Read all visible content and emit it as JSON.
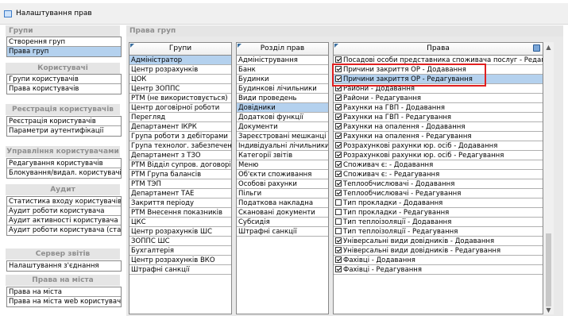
{
  "window": {
    "title": "Налаштування прав"
  },
  "sidebar": {
    "sections": [
      {
        "title": "Групи",
        "items": [
          {
            "label": "Створення груп",
            "selected": false
          },
          {
            "label": "Права груп",
            "selected": true
          }
        ]
      },
      {
        "title": "Користувачі",
        "items": [
          {
            "label": "Групи користувачів",
            "selected": false
          },
          {
            "label": "Права користувачів",
            "selected": false
          }
        ]
      },
      {
        "title": "Реєстрація користувачів",
        "items": [
          {
            "label": "Реєстрація користувачів",
            "selected": false
          },
          {
            "label": "Параметри аутентифікації",
            "selected": false
          }
        ]
      },
      {
        "title": "Управління користувачами",
        "items": [
          {
            "label": "Редагування користувачів",
            "selected": false
          },
          {
            "label": "Блокування/видал. користувачів",
            "selected": false
          }
        ]
      },
      {
        "title": "Аудит",
        "items": [
          {
            "label": "Статистика входу користувачів",
            "selected": false
          },
          {
            "label": "Аудит роботи користувача",
            "selected": false
          },
          {
            "label": "Аудит активності користувача",
            "selected": false
          },
          {
            "label": "Аудит роботи користувача (стари",
            "selected": false
          }
        ]
      },
      {
        "title": "Сервер звітів",
        "items": [
          {
            "label": "Налаштування з'єднання",
            "selected": false
          }
        ]
      },
      {
        "title": "Права на міста",
        "items": [
          {
            "label": "Права на міста",
            "selected": false
          },
          {
            "label": "Права на міста web користувачів",
            "selected": false
          }
        ]
      }
    ]
  },
  "main": {
    "title": "Права груп",
    "groups": {
      "header": "Групи",
      "rows": [
        {
          "label": "Адміністратор",
          "selected": true
        },
        {
          "label": "Центр розрахунків",
          "selected": false
        },
        {
          "label": "ЦОК",
          "selected": false
        },
        {
          "label": "Центр ЗОППС",
          "selected": false
        },
        {
          "label": "РТМ (не використовується)",
          "selected": false
        },
        {
          "label": "Центр договірної роботи",
          "selected": false
        },
        {
          "label": "Перегляд",
          "selected": false
        },
        {
          "label": "Департамент ІКРК",
          "selected": false
        },
        {
          "label": "Група роботи з дебіторами",
          "selected": false
        },
        {
          "label": "Група технолог. забезпечення",
          "selected": false
        },
        {
          "label": "Департамент з ТЗО",
          "selected": false
        },
        {
          "label": "РТМ Відділ супров. договорів",
          "selected": false
        },
        {
          "label": "РТМ Група балансів",
          "selected": false
        },
        {
          "label": "РТМ ТЭП",
          "selected": false
        },
        {
          "label": "Департамент ТАЕ",
          "selected": false
        },
        {
          "label": "Закриття періоду",
          "selected": false
        },
        {
          "label": "РТМ Внесення показників",
          "selected": false
        },
        {
          "label": "ЦКС",
          "selected": false
        },
        {
          "label": "Центр розрахунків ШС",
          "selected": false
        },
        {
          "label": "ЗОППС ШС",
          "selected": false
        },
        {
          "label": "Бухгалтерія",
          "selected": false
        },
        {
          "label": "Центр розрахунків ВКО",
          "selected": false
        },
        {
          "label": "Штрафні санкції",
          "selected": false
        }
      ]
    },
    "sections": {
      "header": "Розділ прав",
      "rows": [
        {
          "label": "Адміністрування",
          "selected": false
        },
        {
          "label": "Банк",
          "selected": false
        },
        {
          "label": "Будинки",
          "selected": false
        },
        {
          "label": "Будинкові лічильники",
          "selected": false
        },
        {
          "label": "Види проведень",
          "selected": false
        },
        {
          "label": "Довідники",
          "selected": true
        },
        {
          "label": "Додаткові функції",
          "selected": false
        },
        {
          "label": "Документи",
          "selected": false
        },
        {
          "label": "Зареєстровані мешканці",
          "selected": false
        },
        {
          "label": "Індивідуальні лічильники",
          "selected": false
        },
        {
          "label": "Категорії звітів",
          "selected": false
        },
        {
          "label": "Меню",
          "selected": false
        },
        {
          "label": "Об'єкти споживання",
          "selected": false
        },
        {
          "label": "Особові рахунки",
          "selected": false
        },
        {
          "label": "Пільги",
          "selected": false
        },
        {
          "label": "Податкова накладна",
          "selected": false
        },
        {
          "label": "Скановані документи",
          "selected": false
        },
        {
          "label": "Субсидія",
          "selected": false
        },
        {
          "label": "Штрафні санкції",
          "selected": false
        }
      ]
    },
    "rights": {
      "header": "Права",
      "rows": [
        {
          "label": "Посадові особи представника споживача послуг - Редагування",
          "checked": true,
          "selected": false
        },
        {
          "label": "Причини закриття ОР - Додавання",
          "checked": true,
          "selected": false
        },
        {
          "label": "Причини закриття ОР - Редагування",
          "checked": true,
          "selected": true
        },
        {
          "label": "Райони - Додавання",
          "checked": true,
          "selected": false
        },
        {
          "label": "Райони - Редагування",
          "checked": true,
          "selected": false
        },
        {
          "label": "Рахунки на ГВП - Додавання",
          "checked": true,
          "selected": false
        },
        {
          "label": "Рахунки на ГВП - Редагування",
          "checked": true,
          "selected": false
        },
        {
          "label": "Рахунки на опалення - Додавання",
          "checked": true,
          "selected": false
        },
        {
          "label": "Рахунки на опалення - Редагування",
          "checked": true,
          "selected": false
        },
        {
          "label": "Розрахункові рахунки юр. осіб - Додавання",
          "checked": true,
          "selected": false
        },
        {
          "label": "Розрахункові рахунки юр. осіб - Редагування",
          "checked": true,
          "selected": false
        },
        {
          "label": "Споживач є: - Додавання",
          "checked": true,
          "selected": false
        },
        {
          "label": "Споживач є: - Редагування",
          "checked": true,
          "selected": false
        },
        {
          "label": "Теплообчислювачі - Додавання",
          "checked": true,
          "selected": false
        },
        {
          "label": "Теплообчислювачі - Редагування",
          "checked": true,
          "selected": false
        },
        {
          "label": "Тип прокладки - Додавання",
          "checked": false,
          "selected": false
        },
        {
          "label": "Тип прокладки - Редагування",
          "checked": false,
          "selected": false
        },
        {
          "label": "Тип теплоізоляції - Додавання",
          "checked": false,
          "selected": false
        },
        {
          "label": "Тип теплоізоляції - Редагування",
          "checked": false,
          "selected": false
        },
        {
          "label": "Універсальні види довідників - Додавання",
          "checked": true,
          "selected": false
        },
        {
          "label": "Універсальні види довідників - Редагування",
          "checked": true,
          "selected": false
        },
        {
          "label": "Фахівці - Додавання",
          "checked": true,
          "selected": false
        },
        {
          "label": "Фахівці - Редагування",
          "checked": true,
          "selected": false
        }
      ]
    }
  },
  "icons": {
    "window": "window-icon",
    "settings": "gear-icon",
    "scroll_up": "chevron-up-icon",
    "scroll_down": "chevron-down-icon"
  },
  "colors": {
    "selection": "#b4d1ee",
    "highlight_box": "#e02020",
    "header_text": "#8f8f8f"
  }
}
